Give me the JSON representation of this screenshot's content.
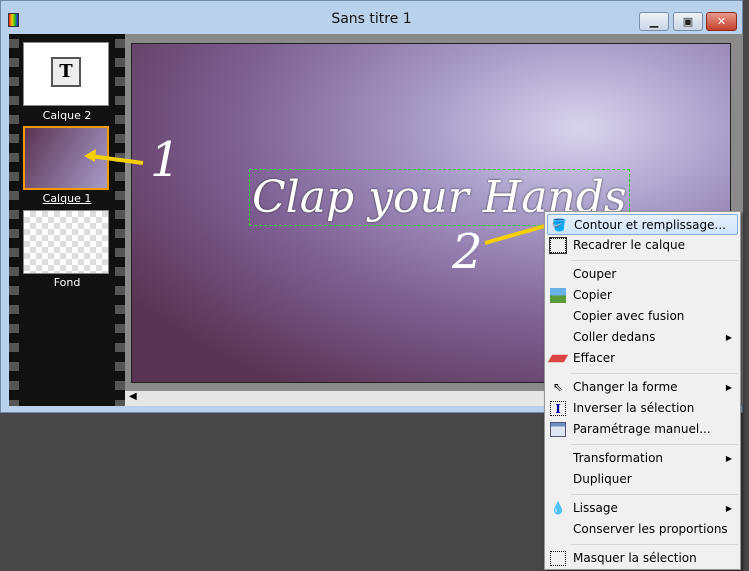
{
  "window": {
    "title": "Sans titre 1"
  },
  "layers": [
    {
      "label": "Calque 2"
    },
    {
      "label": "Calque 1"
    },
    {
      "label": "Fond"
    }
  ],
  "canvas": {
    "text": "Clap your Hands"
  },
  "annotations": [
    "1",
    "2"
  ],
  "menu": {
    "items": [
      {
        "label": "Contour et remplissage...",
        "icon": "paint-bucket-icon"
      },
      {
        "label": "Recadrer le calque",
        "icon": "crop-icon"
      },
      {
        "label": "Couper"
      },
      {
        "label": "Copier",
        "icon": "copy-images-icon"
      },
      {
        "label": "Copier avec fusion"
      },
      {
        "label": "Coller dedans",
        "submenu": true
      },
      {
        "label": "Effacer",
        "icon": "eraser-icon"
      },
      {
        "label": "Changer la forme",
        "icon": "cursor-icon",
        "submenu": true
      },
      {
        "label": "Inverser la sélection",
        "icon": "invert-selection-icon"
      },
      {
        "label": "Paramétrage manuel...",
        "icon": "window-settings-icon"
      },
      {
        "label": "Transformation",
        "submenu": true
      },
      {
        "label": "Dupliquer"
      },
      {
        "label": "Lissage",
        "icon": "drop-icon",
        "submenu": true
      },
      {
        "label": "Conserver les proportions"
      },
      {
        "label": "Masquer la sélection",
        "icon": "hide-selection-icon"
      }
    ]
  }
}
